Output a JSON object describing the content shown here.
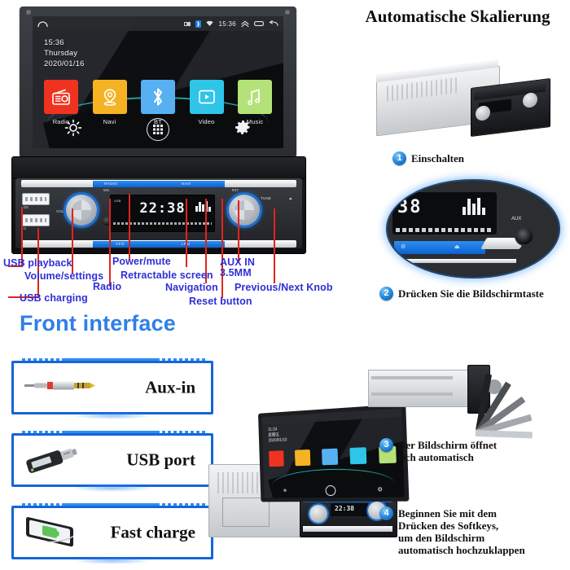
{
  "head_unit_screen": {
    "status_bar": {
      "time": "15:36",
      "icons": [
        "signal-icon",
        "bluetooth-icon",
        "wifi-icon",
        "chevrons-up-icon",
        "recents-icon",
        "back-icon"
      ]
    },
    "clock_widget": {
      "time": "15:36",
      "weekday": "Thursday",
      "date": "2020/01/16"
    },
    "apps": [
      {
        "label": "Radio",
        "icon": "radio-icon",
        "color": "#f0331f"
      },
      {
        "label": "Navi",
        "icon": "location-pin-icon",
        "color": "#f5b324"
      },
      {
        "label": "BT",
        "icon": "bluetooth-icon",
        "color": "#57b0f2"
      },
      {
        "label": "Video",
        "icon": "video-play-icon",
        "color": "#2ec5e8"
      },
      {
        "label": "Music",
        "icon": "music-note-icon",
        "color": "#b5e278"
      }
    ],
    "dock": [
      {
        "name": "brightness-icon"
      },
      {
        "name": "app-drawer-icon"
      },
      {
        "name": "settings-gear-icon"
      }
    ]
  },
  "front_panel": {
    "lcd_time": "22:38",
    "left_knob_label": "VOL",
    "right_knob_label": "TUNE",
    "aux_label": "AUX",
    "mic_label": "MIC",
    "button_labels": {
      "top_left": "RADIO",
      "top_right": "NAVI",
      "bottom_left": "CFG",
      "bottom_right": "LRU"
    }
  },
  "callouts": [
    {
      "text": "USB playback"
    },
    {
      "text": "Volume/settings"
    },
    {
      "text": "USB charging"
    },
    {
      "text": "Radio"
    },
    {
      "text": "Power/mute"
    },
    {
      "text": "Retractable screen"
    },
    {
      "text": "Navigation"
    },
    {
      "text": "Reset button"
    },
    {
      "text": "AUX IN\n3.5MM"
    },
    {
      "text": "Previous/Next Knob"
    }
  ],
  "front_interface": {
    "title": "Front interface",
    "cards": [
      {
        "label": "Aux-in",
        "icon": "aux-plug-icon"
      },
      {
        "label": "USB port",
        "icon": "usb-stick-icon"
      },
      {
        "label": "Fast charge",
        "icon": "phone-charging-icon"
      }
    ]
  },
  "right_column": {
    "title": "Automatische Skalierung",
    "steps": [
      {
        "number": "1",
        "text": "Einschalten"
      },
      {
        "number": "2",
        "text": "Drücken Sie die Bildschirmtaste"
      },
      {
        "number": "3",
        "text": "Der Bildschirm öffnet\nsich automatisch"
      },
      {
        "number": "4",
        "text": "Beginnen Sie mit dem\nDrücken des Softkeys,\num den Bildschirm\nautomatisch hochzuklappen"
      }
    ]
  },
  "inset_zoom": {
    "lcd_digits": "38",
    "aux_label": "AUX"
  },
  "bottom_unit_screen": {
    "time": "11:24",
    "weekday": "星期五",
    "date": "2020/01/10",
    "lcd_time": "22:38"
  },
  "colors": {
    "callout_line": "#e2241a",
    "callout_text": "#2f2fd6",
    "front_interface_blue": "#2f7fe8",
    "card_border": "#1565d8",
    "badge_blue": "#2b8fe0"
  }
}
